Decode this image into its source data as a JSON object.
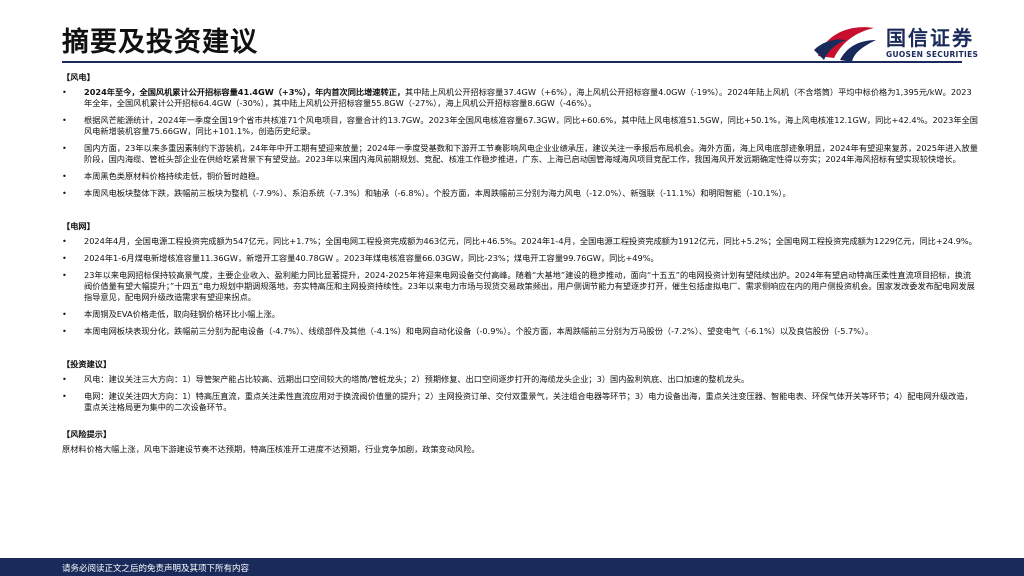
{
  "header": {
    "title": "摘要及投资建议",
    "logo_cn": "国信证券",
    "logo_en": "GUOSEN SECURITIES",
    "brand_colors": {
      "navy": "#1a2a5a",
      "red": "#c8102e"
    }
  },
  "wind": {
    "heading": "【风电】",
    "b1_bold": "2024年至今，全国风机累计公开招标容量41.4GW（+3%），年内首次同比增速转正，",
    "b1_text": "其中陆上风机公开招标容量37.4GW（+6%），海上风机公开招标容量4.0GW（-19%）。2024年陆上风机（不含塔筒）平均中标价格为1,395元/kW。2023年全年，全国风机累计公开招标64.4GW（-30%），其中陆上风机公开招标容量55.8GW（-27%），海上风机公开招标容量8.6GW（-46%）。",
    "b2": "根据风芒能源统计，2024年一季度全国19个省市共核准71个风电项目，容量合计约13.7GW。2023年全国风电核准容量67.3GW，同比+60.6%，其中陆上风电核准51.5GW，同比+50.1%，海上风电核准12.1GW，同比+42.4%。2023年全国风电新增装机容量75.66GW，同比+101.1%，创造历史纪录。",
    "b3": "国内方面，23年以来多重因素制约下游装机，24年年中开工期有望迎来放量；2024年一季度受基数和下游开工节奏影响风电企业业绩承压，建议关注一季报后布局机会。海外方面，海上风电底部迹象明显，2024年有望迎来复苏，2025年进入放量阶段，国内海缆、管桩头部企业在供给吃紧背景下有望受益。2023年以来国内海风前期规划、竞配、核准工作稳步推进，广东、上海已启动国管海域海风项目竞配工作，我国海风开发远期确定性得以夯实；2024年海风招标有望实现较快增长。",
    "b4": "本周黑色类原材料价格持续走低，铜价暂时趋稳。",
    "b5": "本周风电板块整体下跌，跌幅前三板块为整机（-7.9%）、系泊系统（-7.3%）和轴承（-6.8%）。个股方面，本周跌幅前三分别为海力风电（-12.0%）、新强联（-11.1%）和明阳智能（-10.1%）。"
  },
  "grid": {
    "heading": "【电网】",
    "b1": "2024年4月，全国电源工程投资完成额为547亿元，同比+1.7%；全国电网工程投资完成额为463亿元，同比+46.5%。2024年1-4月，全国电源工程投资完成额为1912亿元，同比+5.2%；全国电网工程投资完成额为1229亿元，同比+24.9%。",
    "b2": "2024年1-6月煤电新增核准容量11.36GW，新增开工容量40.78GW 。2023年煤电核准容量66.03GW，同比-23%；煤电开工容量99.76GW，同比+49%。",
    "b3": "23年以来电网招标保持较高景气度，主要企业收入、盈利能力同比显著提升，2024-2025年将迎来电网设备交付高峰。随着“大基地”建设的稳步推动，面向“十五五”的电网投资计划有望陆续出炉。2024年有望启动特高压柔性直流项目招标，换流阀价值量有望大幅提升；”十四五“电力规划中期调规落地，夯实特高压和主网投资持续性。23年以来电力市场与现货交易政策频出，用户侧调节能力有望逐步打开，催生包括虚拟电厂、需求侧响应在内的用户侧投资机会。国家发改委发布配电网发展指导意见，配电网升级改造需求有望迎来拐点。",
    "b4": "本周铜及EVA价格走低，取向硅钢价格环比小幅上涨。",
    "b5": "本周电网板块表现分化，跌幅前三分别为配电设备（-4.7%）、线缆部件及其他（-4.1%）和电网自动化设备（-0.9%）。个股方面，本周跌幅前三分别为万马股份（-7.2%）、望变电气（-6.1%）以及良信股份（-5.7%）。"
  },
  "invest": {
    "heading": "【投资建议】",
    "b1": "风电：建议关注三大方向：1）导管架产能占比较高、远期出口空间较大的塔筒/管桩龙头；2）预期修复、出口空间逐步打开的海缆龙头企业；3）国内盈利筑底、出口加速的整机龙头。",
    "b2": "电网：建议关注四大方向：1）特高压直流，重点关注柔性直流应用对于换流阀价值量的提升；2）主网投资订单、交付双重景气，关注组合电器等环节；3）电力设备出海，重点关注变压器、智能电表、环保气体开关等环节；4）配电网升级改造，重点关注格局更为集中的二次设备环节。"
  },
  "risk": {
    "heading": "【风险提示】",
    "text": "原材料价格大幅上涨，风电下游建设节奏不达预期，特高压核准开工进度不达预期，行业竞争加剧，政策变动风险。"
  },
  "footer": {
    "text": "请务必阅读正文之后的免责声明及其项下所有内容"
  }
}
